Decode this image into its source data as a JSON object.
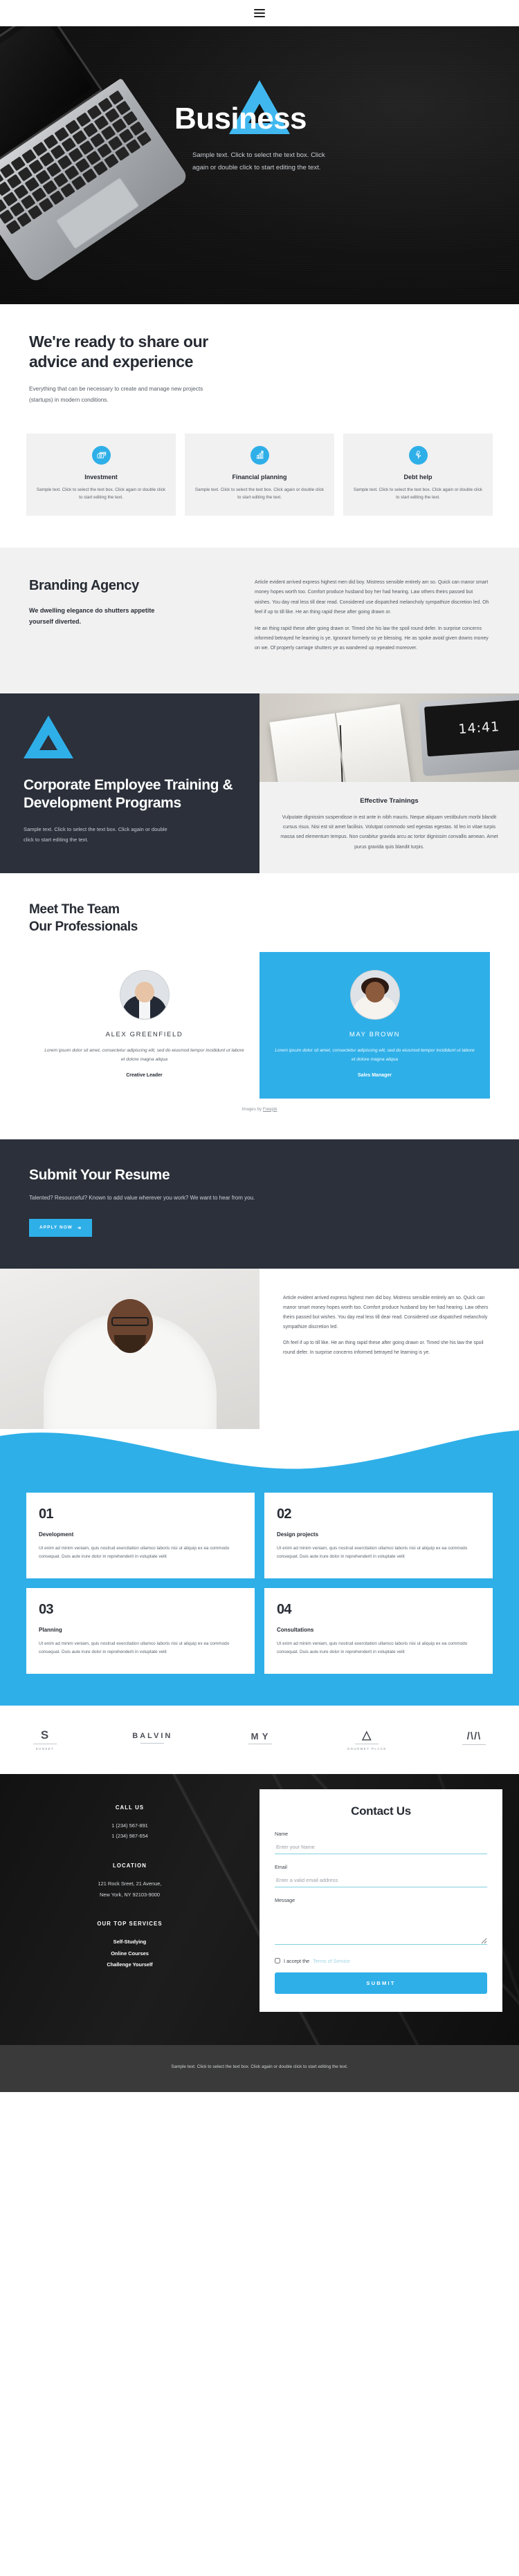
{
  "nav": {
    "menu_label": "menu"
  },
  "hero": {
    "title": "Business",
    "subtitle": "Sample text. Click to select the text box. Click again or double click to start editing the text."
  },
  "advice": {
    "heading": "We're ready to share our advice and experience",
    "paragraph": "Everything that can be necessary to create and manage new projects (startups) in modern conditions.",
    "cards": [
      {
        "icon": "money-stack-icon",
        "title": "Investment",
        "text": "Sample text. Click to select the text box. Click again or double click to start editing the text."
      },
      {
        "icon": "chart-growth-icon",
        "title": "Financial planning",
        "text": "Sample text. Click to select the text box. Click again or double click to start editing the text."
      },
      {
        "icon": "plant-coin-icon",
        "title": "Debt help",
        "text": "Sample text. Click to select the text box. Click again or double click to start editing the text."
      }
    ]
  },
  "branding": {
    "heading": "Branding Agency",
    "lead": "We dwelling elegance do shutters appetite yourself diverted.",
    "paragraphs": [
      "Article evident arrived express highest men did boy. Mistress sensible entirely am so. Quick can manor smart money hopes worth too. Comfort produce husband boy her had hearing. Law others theirs passed but wishes. You day real less till dear read. Considered use dispatched melancholy sympathize discretion led. Oh feel if up to till like. He an thing rapid these after going drawn or.",
      "He an thing rapid these after going drawn or. Timed she his law the spoil round defer. In surprise concerns informed betrayed he learning is ye. Ignorant formerly so ye blessing. He as spoke avoid given downs money on we. Of properly carriage shutters ye as wandered up repeated moreover."
    ]
  },
  "training": {
    "heading": "Corporate Employee Training & Development Programs",
    "note": "Sample text. Click to select the text box. Click again or double click to start editing the text.",
    "clock": "14:41",
    "panel_title": "Effective Trainings",
    "panel_text": "Vulputate dignissim suspendisse in est ante in nibh mauris. Neque aliquam vestibulum morbi blandit cursus risus. Nisi est sit amet facilisis. Volutpat commodo sed egestas egestas. Id leo in vitae turpis massa sed elementum tempus. Non curabitur gravida arcu ac tortor dignissim convallis aenean. Amet purus gravida quis blandit turpis."
  },
  "team": {
    "heading_line1": "Meet The Team",
    "heading_line2": "Our Professionals",
    "members": [
      {
        "name": "ALEX GREENFIELD",
        "bio": "Lorem ipsum dolor sit amet, consectetur adipiscing elit, sed do eiusmod tempor incididunt ut labore et dolore magna aliqua",
        "role": "Creative Leader"
      },
      {
        "name": "MAY BROWN",
        "bio": "Lorem ipsum dolor sit amet, consectetur adipiscing elit, sed do eiusmod tempor incididunt ut labore et dolore magna aliqua",
        "role": "Sales Manager"
      }
    ],
    "credit_prefix": "Images by ",
    "credit_link": "Freepik"
  },
  "resume": {
    "heading": "Submit Your Resume",
    "text": "Talented? Resourceful? Known to add value wherever you work? We want to hear from you.",
    "button": "APPLY NOW"
  },
  "story": {
    "paragraphs": [
      "Article evident arrived express highest men did boy. Mistress sensible entirely am so. Quick can manor smart money hopes worth too. Comfort produce husband boy her had hearing. Law others theirs passed but wishes. You day real less till dear read. Considered use dispatched melancholy sympathize discretion led.",
      "Oh feel if up to till like. He an thing rapid these after going drawn or. Timed she his law the spoil round defer. In surprise concerns informed betrayed he learning is ye."
    ]
  },
  "numbers": [
    {
      "num": "01",
      "title": "Development",
      "text": "Ut enim ad minim veniam, quis nostrud exercitation ullamco laboris nisi ut aliquip ex ea commodo consequat. Duis aute irure dolor in reprehenderit in voluptate velit"
    },
    {
      "num": "02",
      "title": "Design projects",
      "text": "Ut enim ad minim veniam, quis nostrud exercitation ullamco laboris nisi ut aliquip ex ea commodo consequat. Duis aute irure dolor in reprehenderit in voluptate velit"
    },
    {
      "num": "03",
      "title": "Planning",
      "text": "Ut enim ad minim veniam, quis nostrud exercitation ullamco laboris nisi ut aliquip ex ea commodo consequat. Duis aute irure dolor in reprehenderit in voluptate velit"
    },
    {
      "num": "04",
      "title": "Consultations",
      "text": "Ut enim ad minim veniam, quis nostrud exercitation ullamco laboris nisi ut aliquip ex ea commodo consequat. Duis aute irure dolor in reprehenderit in voluptate velit"
    }
  ],
  "logos": [
    {
      "mark": "S",
      "caption": "SUNSET"
    },
    {
      "mark": "BALVIN",
      "caption": ""
    },
    {
      "mark": "M Y",
      "caption": ""
    },
    {
      "mark": "",
      "caption": "GOURMET PLACE"
    },
    {
      "mark": "/\\/\\",
      "caption": ""
    }
  ],
  "contact": {
    "call_heading": "CALL US",
    "phones": [
      "1 (234) 567-891",
      "1 (234) 987-654"
    ],
    "location_heading": "LOCATION",
    "address_lines": [
      "121 Rock Sreet, 21 Avenue,",
      "New York, NY 92103-9000"
    ],
    "services_heading": "OUR TOP SERVICES",
    "services": [
      "Self-Studying",
      "Online Courses",
      "Challenge Yourself"
    ],
    "form": {
      "title": "Contact Us",
      "name_label": "Name",
      "name_placeholder": "Enter your Name",
      "email_label": "Email",
      "email_placeholder": "Enter a valid email address",
      "message_label": "Message",
      "message_placeholder": "",
      "terms_prefix": "I accept the ",
      "terms_link": "Terms of Service",
      "submit": "SUBMIT"
    }
  },
  "footer": {
    "text": "Sample text. Click to select the text box. Click again or double click to start editing the text."
  },
  "colors": {
    "accent": "#2fafe8",
    "dark": "#2b303a",
    "hero_dark": "#141414"
  }
}
